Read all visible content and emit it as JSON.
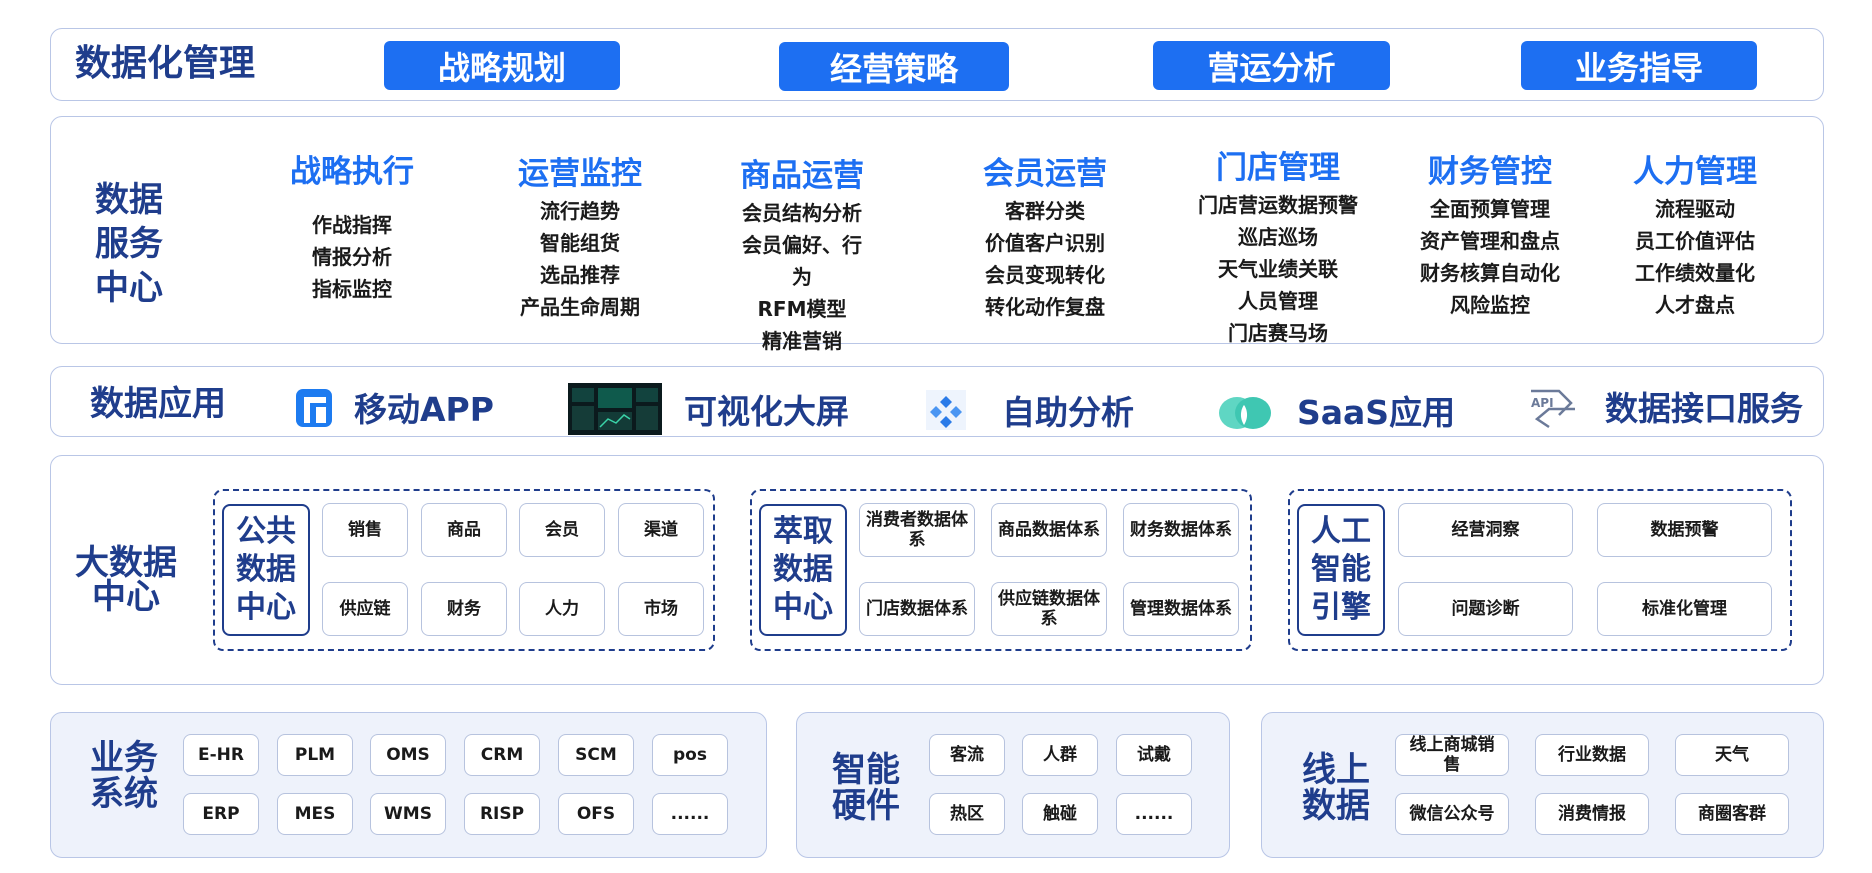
{
  "top": {
    "title": "数据化管理",
    "buttons": [
      "战略规划",
      "经营策略",
      "营运分析",
      "业务指导"
    ]
  },
  "service": {
    "title": "数据服务中心",
    "columns": [
      {
        "head": "战略执行",
        "items": [
          "作战指挥",
          "情报分析",
          "指标监控"
        ]
      },
      {
        "head": "运营监控",
        "items": [
          "流行趋势",
          "智能组货",
          "选品推荐",
          "产品生命周期"
        ]
      },
      {
        "head": "商品运营",
        "items": [
          "会员结构分析",
          "会员偏好、行为",
          "RFM模型",
          "精准营销"
        ]
      },
      {
        "head": "会员运营",
        "items": [
          "客群分类",
          "价值客户识别",
          "会员变现转化",
          "转化动作复盘"
        ]
      },
      {
        "head": "门店管理",
        "items": [
          "门店营运数据预警",
          "巡店巡场",
          "天气业绩关联",
          "人员管理",
          "门店赛马场"
        ]
      },
      {
        "head": "财务管控",
        "items": [
          "全面预算管理",
          "资产管理和盘点",
          "财务核算自动化",
          "风险监控"
        ]
      },
      {
        "head": "人力管理",
        "items": [
          "流程驱动",
          "员工价值评估",
          "工作绩效量化",
          "人才盘点"
        ]
      }
    ]
  },
  "apps": {
    "title": "数据应用",
    "items": [
      {
        "label": "移动APP",
        "icon": "mobile-app-icon"
      },
      {
        "label": "可视化大屏",
        "icon": "dashboard-screen-icon"
      },
      {
        "label": "自助分析",
        "icon": "self-analysis-icon"
      },
      {
        "label": "SaaS应用",
        "icon": "saas-cloud-icon"
      },
      {
        "label": "数据接口服务",
        "icon": "api-interface-icon"
      }
    ]
  },
  "bigdata": {
    "title": "大数据中心",
    "groups": [
      {
        "label": "公共数据中心",
        "items": [
          "销售",
          "商品",
          "会员",
          "渠道",
          "供应链",
          "财务",
          "人力",
          "市场"
        ]
      },
      {
        "label": "萃取数据中心",
        "items": [
          "消费者数据体系",
          "商品数据体系",
          "财务数据体系",
          "门店数据体系",
          "供应链数据体系",
          "管理数据体系"
        ]
      },
      {
        "label": "人工智能引擎",
        "items": [
          "经营洞察",
          "数据预警",
          "问题诊断",
          "标准化管理"
        ]
      }
    ]
  },
  "bottom": [
    {
      "title": "业务系统",
      "items": [
        "E-HR",
        "PLM",
        "OMS",
        "CRM",
        "SCM",
        "pos",
        "ERP",
        "MES",
        "WMS",
        "RISP",
        "OFS",
        "......"
      ]
    },
    {
      "title": "智能硬件",
      "items": [
        "客流",
        "人群",
        "试戴",
        "热区",
        "触碰",
        "......"
      ]
    },
    {
      "title": "线上数据",
      "items": [
        "线上商城销售",
        "行业数据",
        "天气",
        "微信公众号",
        "消费情报",
        "商圈客群"
      ]
    }
  ],
  "colors": {
    "accent": "#1d6ff2",
    "navy": "#1f3d8c",
    "border": "#b9c6e6",
    "tint": "#eef2fb"
  }
}
